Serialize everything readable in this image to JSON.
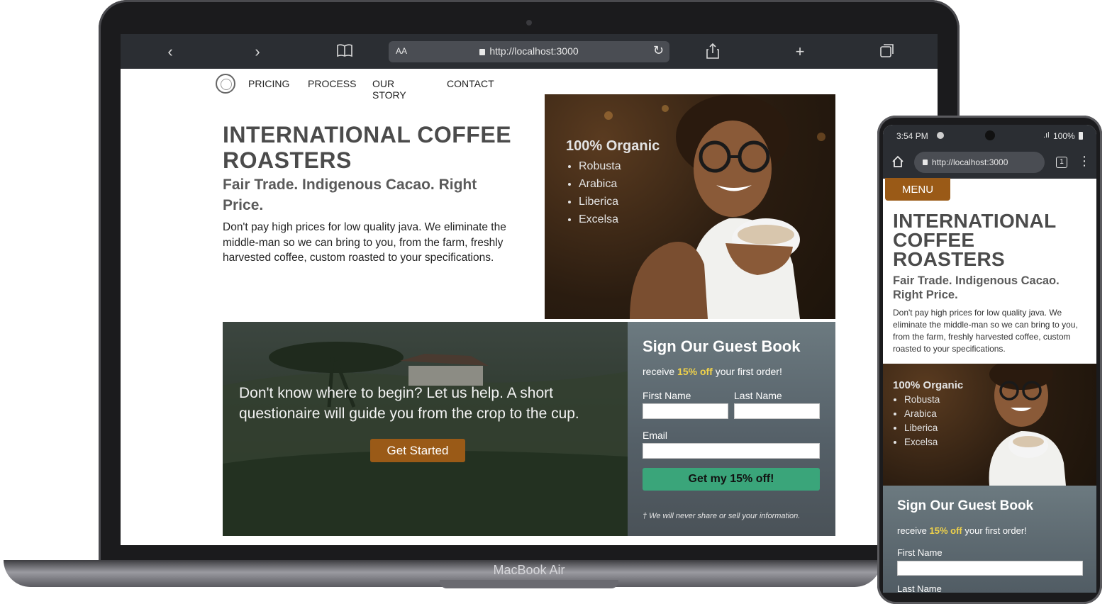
{
  "laptop": {
    "model_label": "MacBook Air",
    "browser": {
      "text_size_label": "AA",
      "url": "http://localhost:3000"
    }
  },
  "site": {
    "nav": [
      "PRICING",
      "PROCESS",
      "OUR STORY",
      "CONTACT"
    ],
    "hero": {
      "title": "INTERNATIONAL COFFEE ROASTERS",
      "subtitle": "Fair Trade. Indigenous Cacao. Right Price.",
      "body": "Don't pay high prices for low quality java. We eliminate the middle-man so we can bring to you, from the farm, freshly harvested coffee, custom roasted to your specifications."
    },
    "organic": {
      "heading": "100% Organic",
      "items": [
        "Robusta",
        "Arabica",
        "Liberica",
        "Excelsa"
      ]
    },
    "cta": {
      "text": "Don't know where to begin? Let us help. A short questionaire will guide you from the crop to the cup.",
      "button": "Get Started"
    },
    "guestbook": {
      "title": "Sign Our Guest Book",
      "offer_prefix": "receive ",
      "offer_highlight": "15% off",
      "offer_suffix": " your first order!",
      "first_name_label": "First Name",
      "last_name_label": "Last Name",
      "email_label": "Email",
      "submit": "Get my 15% off!",
      "disclaimer": "† We will never share or sell your information."
    }
  },
  "phone": {
    "time": "3:54 PM",
    "battery": "100%",
    "url": "http://localhost:3000",
    "tab_count": "1",
    "menu_button": "MENU",
    "last_name_label_partial": "Last Name"
  },
  "colors": {
    "accent_brown": "#9a5a17",
    "accent_green": "#3aa57a",
    "highlight_yellow": "#f0d24a"
  }
}
